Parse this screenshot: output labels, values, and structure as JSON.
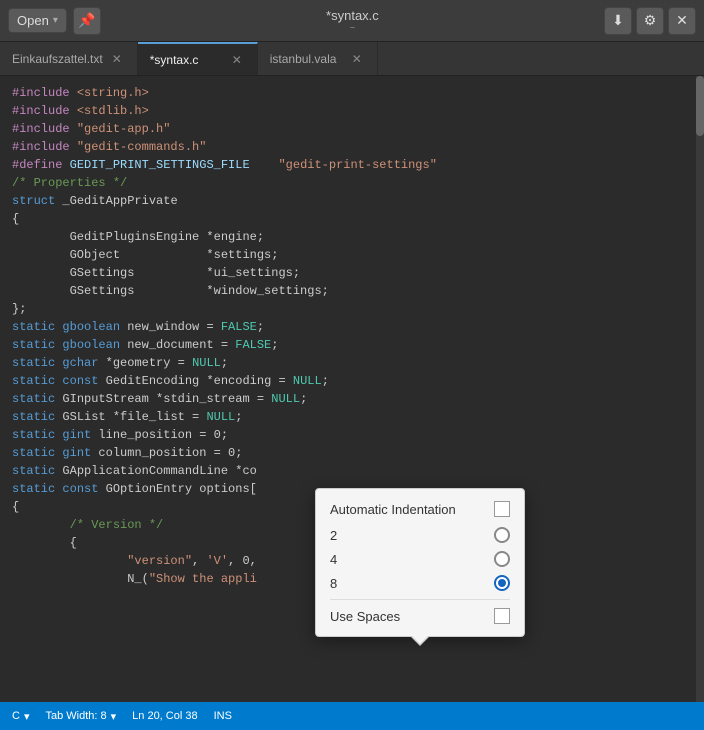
{
  "titleBar": {
    "openLabel": "Open",
    "title": "*syntax.c",
    "subtitle": "~",
    "downloadIcon": "⬇",
    "settingsIcon": "⚙",
    "closeIcon": "✕"
  },
  "tabs": [
    {
      "label": "Einkaufszattel.txt",
      "active": false,
      "modified": false
    },
    {
      "label": "*syntax.c",
      "active": true,
      "modified": true
    },
    {
      "label": "istanbul.vala",
      "active": false,
      "modified": false
    }
  ],
  "codeLines": [
    "#include <string.h>",
    "#include <stdlib.h>",
    "",
    "#include \"gedit-app.h\"",
    "#include \"gedit-commands.h\"",
    "",
    "#define GEDIT_PRINT_SETTINGS_FILE    \"gedit-print-settings\"",
    "/* Properties */",
    "",
    "struct _GeditAppPrivate",
    "{",
    "        GeditPluginsEngine *engine;",
    "        GObject            *settings;",
    "        GSettings          *ui_settings;",
    "        GSettings          *window_settings;",
    "};",
    "",
    "static gboolean new_window = FALSE;",
    "static gboolean new_document = FALSE;",
    "static gchar *geometry = NULL;",
    "static const GeditEncoding *encoding = NULL;",
    "static GInputStream *stdin_stream = NULL;",
    "static GSList *file_list = NULL;",
    "static gint line_position = 0;",
    "static gint column_position = 0;",
    "static GApplicationCommandLine *co",
    "",
    "static const GOptionEntry options[",
    "{",
    "        /* Version */",
    "        {",
    "                \"version\", 'V', 0,",
    "                N_(\"Show the appli"
  ],
  "popup": {
    "title": "Automatic Indentation",
    "checked": false,
    "options": [
      {
        "label": "2",
        "selected": false
      },
      {
        "label": "4",
        "selected": false
      },
      {
        "label": "8",
        "selected": true
      }
    ],
    "useSpacesLabel": "Use Spaces",
    "useSpacesChecked": false
  },
  "statusBar": {
    "language": "C",
    "tabWidth": "Tab Width: 8",
    "position": "Ln 20, Col 38",
    "mode": "INS"
  }
}
